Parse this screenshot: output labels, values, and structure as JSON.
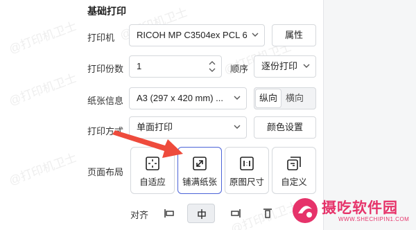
{
  "section_title": "基础打印",
  "printer": {
    "label": "打印机",
    "value": "RICOH MP C3504ex PCL 6",
    "props_button": "属性"
  },
  "copies": {
    "label": "打印份数",
    "value": "1",
    "order_label": "顺序",
    "order_value": "逐份打印"
  },
  "paper": {
    "label": "纸张信息",
    "value": "A3 (297 x 420 mm) ...",
    "orientation": [
      "纵向",
      "横向"
    ],
    "orientation_selected": "纵向"
  },
  "method": {
    "label": "打印方式",
    "value": "单面打印",
    "color_button": "颜色设置"
  },
  "layout": {
    "label": "页面布局",
    "options": [
      "自适应",
      "铺满纸张",
      "原图尺寸",
      "自定义"
    ],
    "selected": "铺满纸张"
  },
  "align": {
    "label": "对齐",
    "selected": "center-horizontal"
  },
  "watermark_text": "@打印机卫士",
  "brand": {
    "name": "摄吃软件园",
    "url": "WWW.SHECHIPIN1.COM",
    "color": "#e6336a"
  },
  "accent_color": "#4b63d8",
  "arrow_color": "#ee4b3c"
}
